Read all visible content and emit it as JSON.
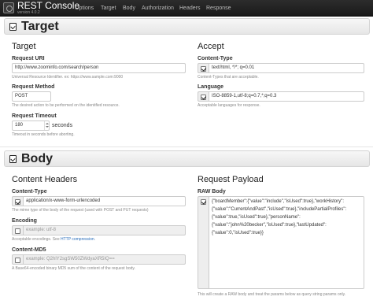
{
  "app": {
    "title": "REST Console",
    "version": "version 4.0.2"
  },
  "nav": {
    "items": [
      "Options",
      "Target",
      "Body",
      "Authorization",
      "Headers",
      "Response"
    ]
  },
  "target": {
    "section_title": "Target",
    "panel_title": "Target",
    "request_uri": {
      "label": "Request URI",
      "value": "http://www.zoominfo.com/search/person",
      "help": "Universal Resource Identifier. ex: https://www.sample.com:9000"
    },
    "request_method": {
      "label": "Request Method",
      "value": "POST",
      "help": "The desired action to be performed on the identified resource."
    },
    "request_timeout": {
      "label": "Request Timeout",
      "value": "180",
      "unit": "seconds",
      "help": "Timeout in seconds before aborting."
    }
  },
  "accept": {
    "panel_title": "Accept",
    "content_type": {
      "label": "Content-Type",
      "value": "text/html, */*; q=0.01",
      "help": "Content-Types that are acceptable.",
      "checked": true
    },
    "language": {
      "label": "Language",
      "value": "ISO-8859-1,utf-8;q=0.7,*;q=0.3",
      "help": "Acceptable languages for response.",
      "checked": true
    }
  },
  "body": {
    "section_title": "Body",
    "content_headers": {
      "panel_title": "Content Headers",
      "content_type": {
        "label": "Content-Type",
        "value": "application/x-www-form-urlencoded",
        "help": "The mime type of the body of the request (used with POST and PUT requests)",
        "checked": true
      },
      "encoding": {
        "label": "Encoding",
        "placeholder": "example: utf-8",
        "help_prefix": "Acceptable encodings. See ",
        "help_link": "HTTP compression",
        "help_suffix": ".",
        "checked": false
      },
      "content_md5": {
        "label": "Content-MD5",
        "placeholder": "example: Q2hlY2sgSW50ZWdyaXR5IQ==",
        "help": "A Base64-encoded binary MD5 sum of the content of the request body.",
        "checked": false
      }
    },
    "request_payload": {
      "panel_title": "Request Payload",
      "raw_body": {
        "label": "RAW Body",
        "checked": true,
        "value": "{\"boardMember\":{\"value\":\"include\",\"isUsed\":true},\"workHistory\":{\"value\":\"CurrentAndPast\",\"isUsed\":true},\"includePartialProfiles\":{\"value\":true,\"isUsed\":true},\"personName\":{\"value\":\"john%20becker\",\"isUsed\":true},\"lastUpdated\":{\"value\":0,\"isUsed\":true}}",
        "help": "This will create a RAW body and treat the params below as query string params only."
      }
    }
  }
}
